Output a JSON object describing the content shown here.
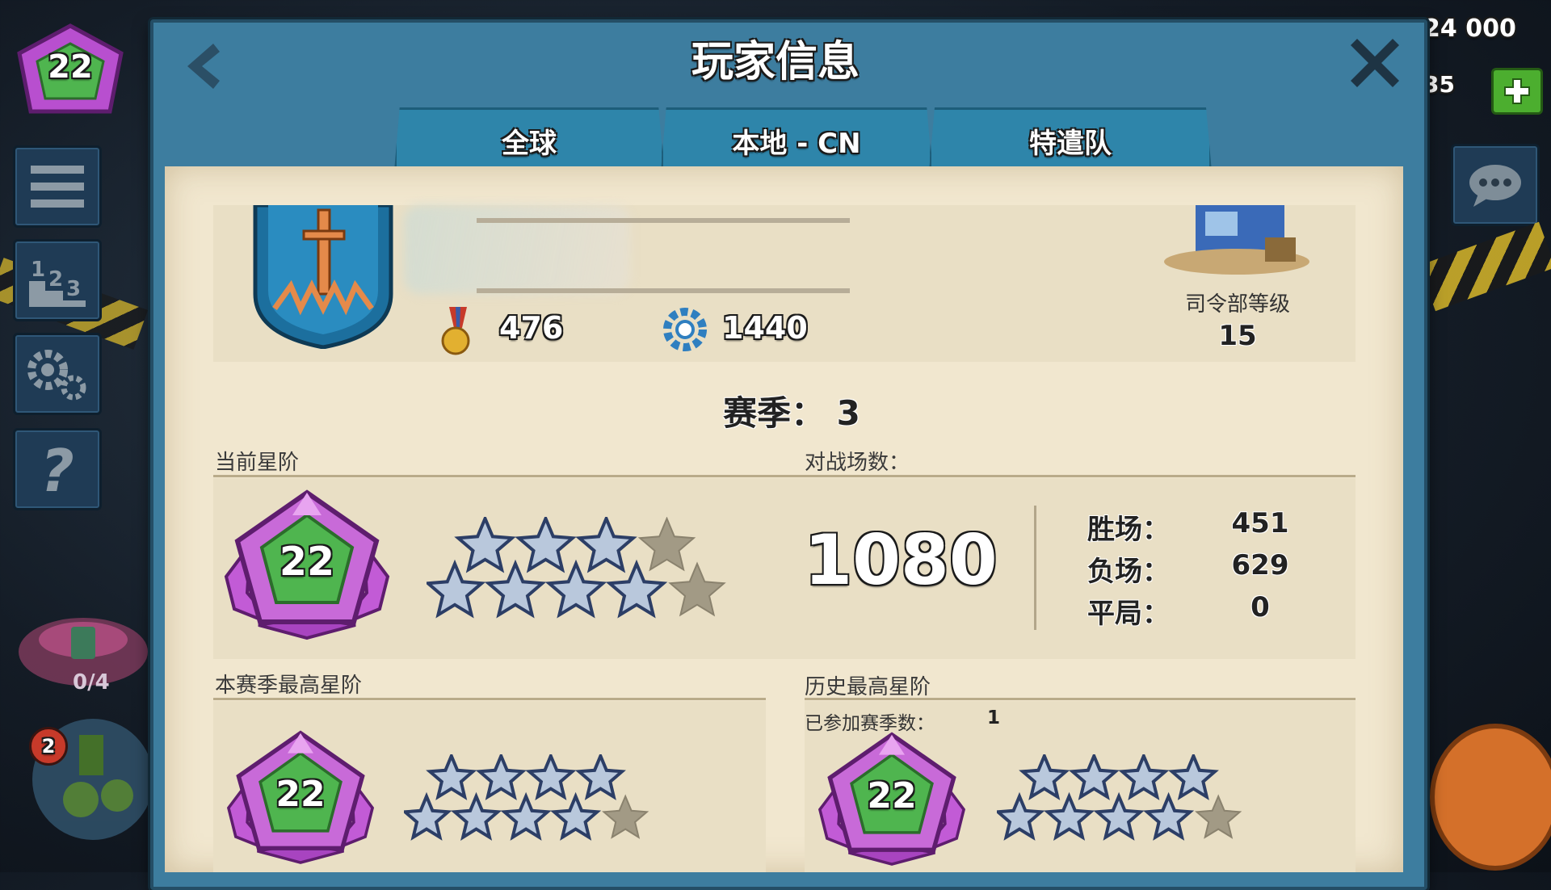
{
  "hud": {
    "level_badge": "22",
    "resource_amount": "24 000",
    "resource_amount2": "35",
    "side_menu": [
      "menu-icon",
      "leaderboard-icon",
      "settings-icon",
      "help-icon"
    ],
    "vault_progress": "0/4",
    "troop_badge_count": "2"
  },
  "dialog": {
    "title": "玩家信息",
    "tabs": [
      "全球",
      "本地 - CN",
      "特遣队"
    ]
  },
  "profile": {
    "medals": "476",
    "intel": "1440",
    "hq_label": "司令部等级",
    "hq_level": "15"
  },
  "season": {
    "label": "赛季： 3"
  },
  "current_rank": {
    "label": "当前星阶",
    "level": "22",
    "stars_filled": 7,
    "stars_total": 9
  },
  "battles": {
    "label": "对战场数：",
    "total": "1080",
    "wins_label": "胜场：",
    "wins": "451",
    "losses_label": "负场：",
    "losses": "629",
    "draws_label": "平局：",
    "draws": "0"
  },
  "season_best": {
    "label": "本赛季最高星阶",
    "level": "22",
    "stars_filled": 8,
    "stars_total": 9
  },
  "history_best": {
    "label": "历史最高星阶",
    "seasons_joined_label": "已参加赛季数：",
    "seasons_joined": "1",
    "level": "22",
    "stars_filled": 8,
    "stars_total": 9
  },
  "colors": {
    "rank_badge": "#c86ad8",
    "rank_inner": "#4fb54f",
    "star_filled": "#b9c8dc",
    "star_empty": "#a29a85",
    "dialog_frame": "#3d7d9f",
    "paper": "#f1e7cf"
  }
}
